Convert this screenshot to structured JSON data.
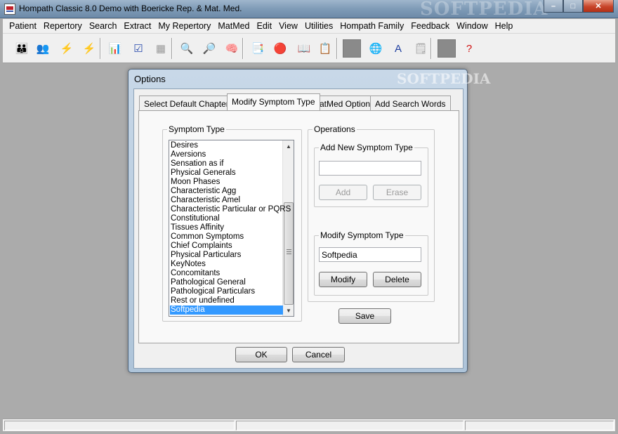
{
  "window": {
    "title": "Hompath Classic 8.0 Demo with Boericke Rep. & Mat. Med.",
    "watermark": "SOFTPEDIA",
    "minimize_glyph": "–",
    "maximize_glyph": "□",
    "close_glyph": "✕"
  },
  "menu": [
    "Patient",
    "Repertory",
    "Search",
    "Extract",
    "My Repertory",
    "MatMed",
    "Edit",
    "View",
    "Utilities",
    "Hompath Family",
    "Feedback",
    "Window",
    "Help"
  ],
  "toolbar": {
    "icons": [
      {
        "name": "patients-green-icon",
        "glyph": "👪",
        "color": "#2e8b2e"
      },
      {
        "name": "patients-red-icon",
        "glyph": "👥",
        "color": "#b22222"
      },
      {
        "name": "lightning-icon",
        "glyph": "⚡",
        "color": "#1e5bd6"
      },
      {
        "name": "lightning-disabled-icon",
        "glyph": "⚡",
        "color": "#9a9a9a"
      },
      {
        "name": "repertory-sheet-icon",
        "glyph": "📊",
        "color": "#c07000"
      },
      {
        "name": "chart-window-icon",
        "glyph": "☑",
        "color": "#2244aa"
      },
      {
        "name": "grid-disabled-icon",
        "glyph": "▦",
        "color": "#9a9a9a"
      },
      {
        "name": "search-chart-icon",
        "glyph": "🔍",
        "color": "#1f3f9f"
      },
      {
        "name": "search-alt-icon",
        "glyph": "🔎",
        "color": "#8b1a1a"
      },
      {
        "name": "head-profile-icon",
        "glyph": "🧠",
        "color": "#c02020"
      },
      {
        "name": "materia-medica-icon",
        "glyph": "📑",
        "color": "#b01818"
      },
      {
        "name": "remedy-balls-icon",
        "glyph": "🔴",
        "color": "#d02020"
      },
      {
        "name": "book-icon",
        "glyph": "📖",
        "color": "#3a2a1a"
      },
      {
        "name": "checklist-icon",
        "glyph": "📋",
        "color": "#1a7a1a"
      },
      {
        "name": "disabled-tool-icon",
        "glyph": "",
        "color": "#888888"
      },
      {
        "name": "globe-page-icon",
        "glyph": "🌐",
        "color": "#1f4fbf"
      },
      {
        "name": "font-page-icon",
        "glyph": "A",
        "color": "#1f3fa0"
      },
      {
        "name": "note-disabled-icon",
        "glyph": "🗒",
        "color": "#9a9a9a"
      },
      {
        "name": "disabled-tool-2-icon",
        "glyph": "",
        "color": "#888888"
      },
      {
        "name": "help-icon",
        "glyph": "?",
        "color": "#d01010"
      }
    ]
  },
  "dialog": {
    "title": "Options",
    "tabs": [
      "Select Default Chapters",
      "Modify Symptom Type",
      "MatMed Options",
      "Add Search Words"
    ],
    "active_tab": "Modify Symptom Type",
    "symptom_type_label": "Symptom Type",
    "symptom_types": [
      "Desires",
      "Aversions",
      "Sensation as if",
      "Physical Generals",
      "Moon Phases",
      "Characteristic Agg",
      "Characteristic Amel",
      "Characteristic Particular or PQRS",
      "Constitutional",
      "Tissues Affinity",
      "Common Symptoms",
      "Chief Complaints",
      "Physical Particulars",
      "KeyNotes",
      "Concomitants",
      "Pathological General",
      "Pathological Particulars",
      "Rest or undefined",
      "Softpedia"
    ],
    "selected_symptom": "Softpedia",
    "operations_label": "Operations",
    "add_new_label": "Add New Symptom Type",
    "add_new_value": "",
    "add_button": "Add",
    "erase_button": "Erase",
    "modify_label": "Modify Symptom Type",
    "modify_value": "Softpedia",
    "modify_button": "Modify",
    "delete_button": "Delete",
    "save_button": "Save",
    "ok_button": "OK",
    "cancel_button": "Cancel"
  }
}
